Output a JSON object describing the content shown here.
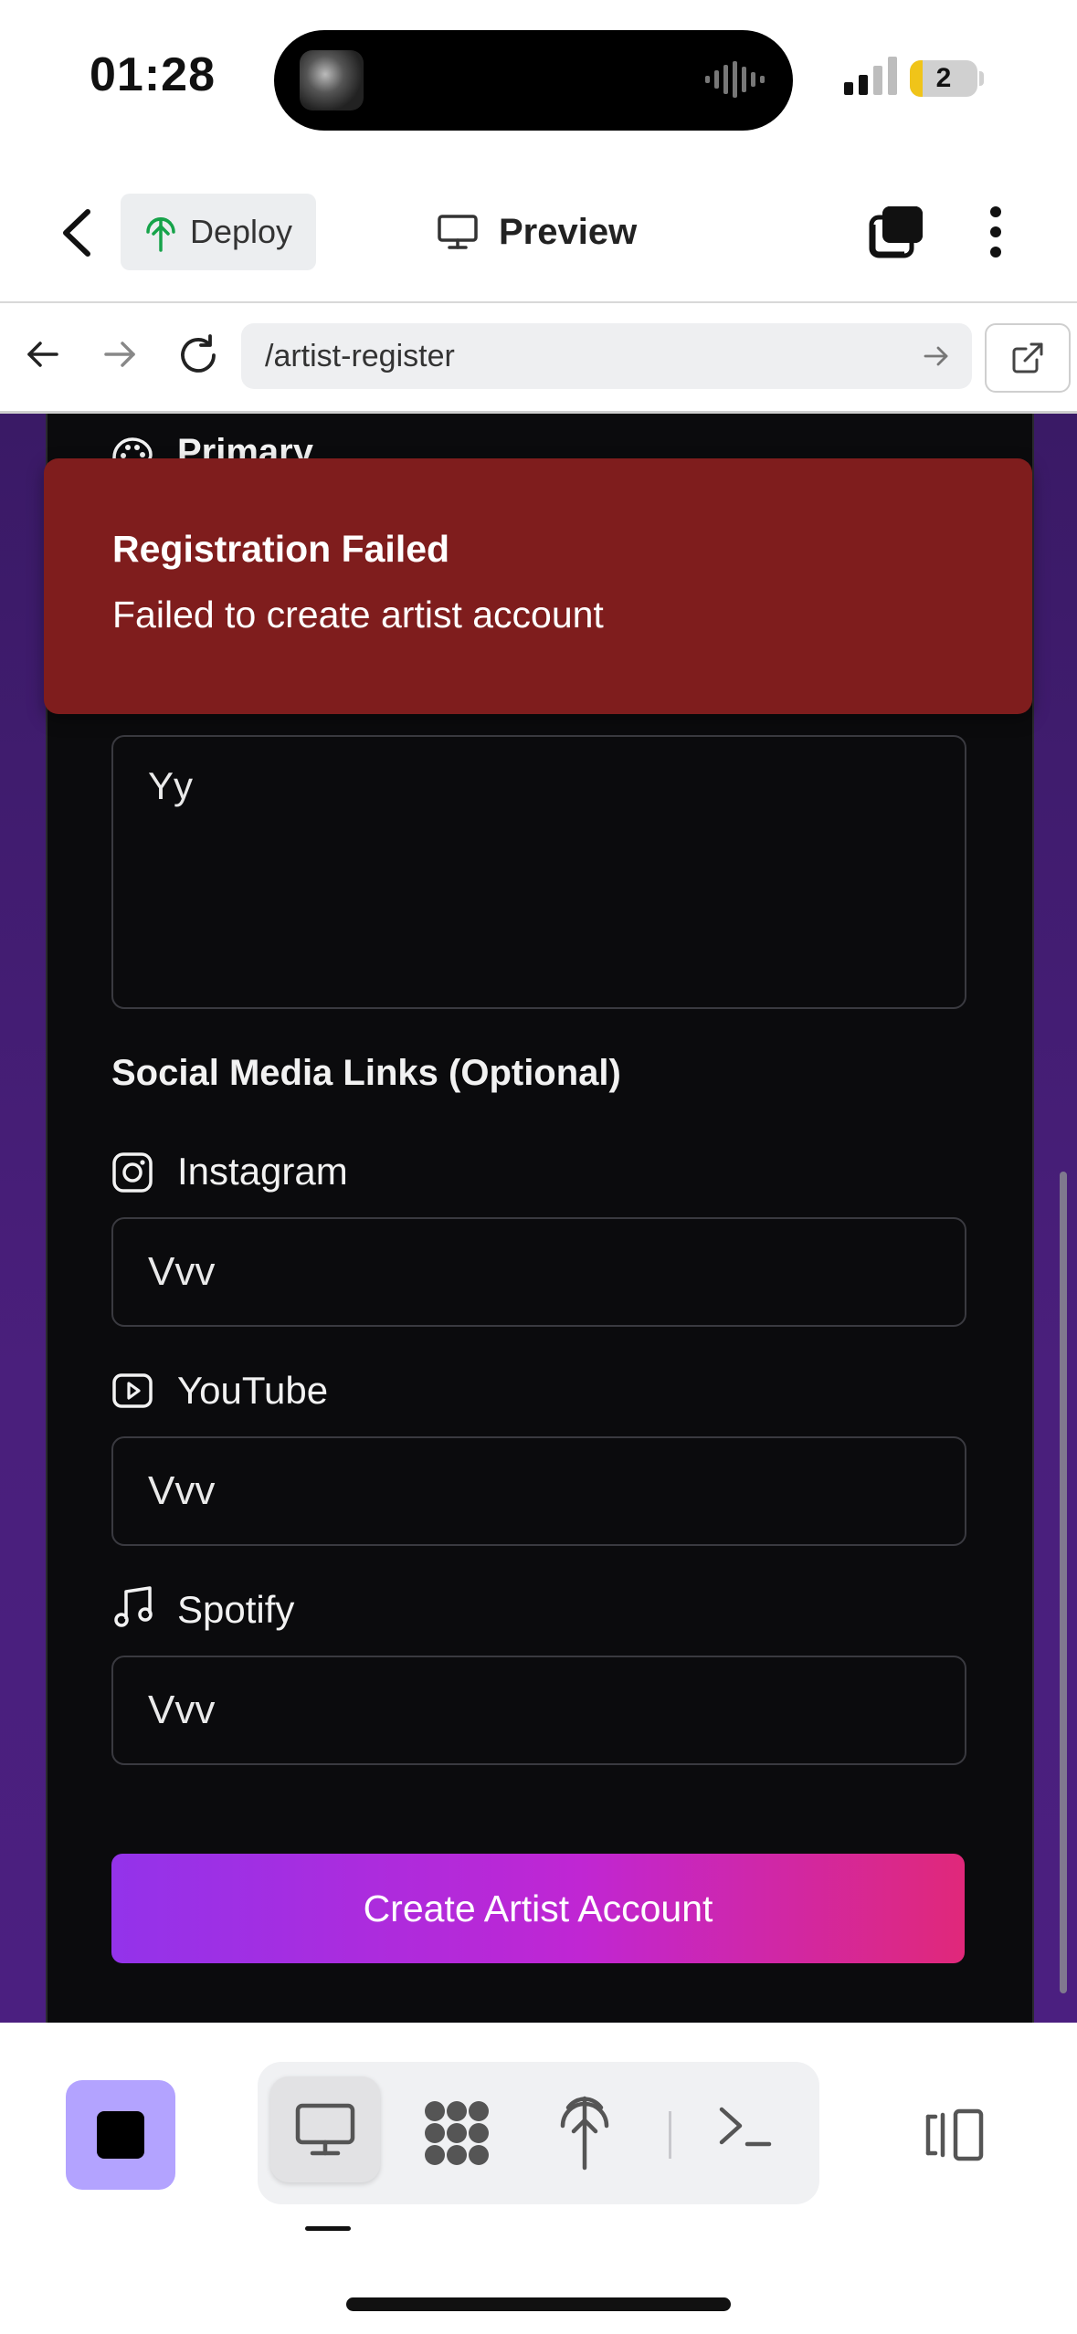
{
  "status_bar": {
    "time": "01:28",
    "battery": "2"
  },
  "header": {
    "deploy_label": "Deploy",
    "preview_label": "Preview"
  },
  "browser": {
    "url": "/artist-register"
  },
  "form": {
    "genre_label": "Primary Genre",
    "bio_value": "Yy",
    "social_title": "Social Media Links (Optional)",
    "instagram": {
      "label": "Instagram",
      "value": "Vvv"
    },
    "youtube": {
      "label": "YouTube",
      "value": "Vvv"
    },
    "spotify": {
      "label": "Spotify",
      "value": "Vvv"
    },
    "submit_label": "Create Artist Account"
  },
  "toast": {
    "title": "Registration Failed",
    "message": "Failed to create artist account"
  },
  "colors": {
    "toast_bg": "#7f1d1d",
    "button_gradient_start": "#9333ea",
    "button_gradient_end": "#e0287a",
    "stop_button": "#b3a3ff",
    "deploy_icon": "#16a34a"
  },
  "icons": {
    "header": [
      "back-chevron-icon",
      "deploy-tree-icon",
      "monitor-icon",
      "tabs-icon",
      "more-vertical-icon"
    ],
    "browser": [
      "arrow-left-icon",
      "arrow-right-icon",
      "reload-icon",
      "url-go-arrow-icon",
      "open-external-icon"
    ],
    "form": [
      "palette-icon",
      "instagram-icon",
      "youtube-icon",
      "music-note-icon"
    ],
    "toolbar": [
      "stop-icon",
      "monitor-icon",
      "apps-icon",
      "deploy-icon",
      "terminal-icon",
      "panel-toggle-icon"
    ]
  }
}
